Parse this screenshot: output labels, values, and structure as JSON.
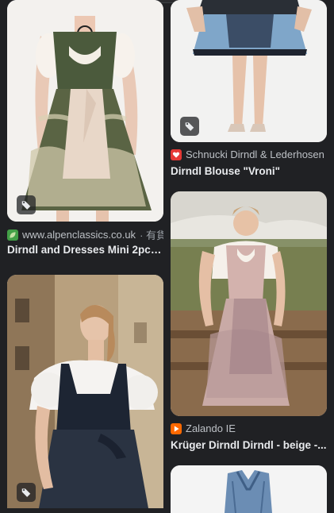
{
  "results": [
    {
      "source": "www.alpenclassics.co.uk",
      "source_suffix": " · 有貨",
      "title": "Dirndl and Dresses Mini 2pcs....",
      "favicon_color": "#43a047",
      "favicon_icon": "green-leaf-icon"
    },
    {
      "source": "Schnucki Dirndl & Lederhosen",
      "source_suffix": "",
      "title": "Dirndl Blouse \"Vroni\"",
      "favicon_color": "#e53935",
      "favicon_icon": "red-heart-icon"
    },
    {
      "source": "Zalando IE",
      "source_suffix": "",
      "title": "Krüger Dirndl Dirndl - beige -...",
      "favicon_color": "#ff6900",
      "favicon_icon": "orange-square-icon"
    }
  ],
  "images": [
    {
      "alt": "Woman in green and cream lace dirndl with satin apron"
    },
    {
      "alt": "Woman in blue dirndl skirt, legs visible"
    },
    {
      "alt": "Woman in beige dirndl with mauve apron outdoors"
    },
    {
      "alt": "Woman in black dirndl with white lace blouse on street"
    },
    {
      "alt": "Blue denim dirndl bodice"
    }
  ],
  "colors": {
    "background": "#202124",
    "text_primary": "#e8eaed",
    "text_secondary": "#bdc1c6"
  }
}
